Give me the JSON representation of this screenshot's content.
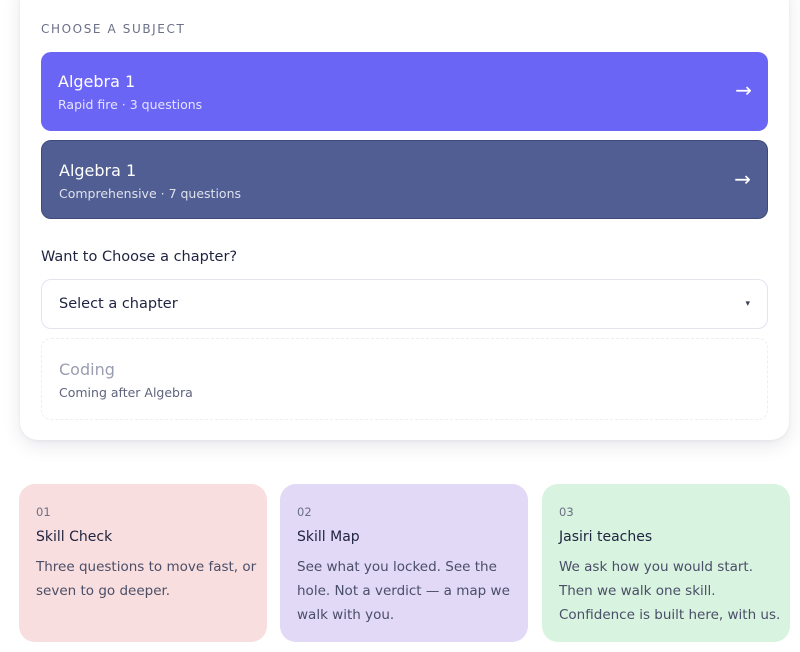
{
  "subject_picker": {
    "section_label": "CHOOSE A SUBJECT",
    "options": [
      {
        "title": "Algebra 1",
        "subtitle": "Rapid fire · 3 questions",
        "arrow": "→"
      },
      {
        "title": "Algebra 1",
        "subtitle": "Comprehensive · 7 questions",
        "arrow": "→"
      }
    ],
    "chapter_prompt": "Want to Choose a chapter?",
    "chapter_select": {
      "selected": "Select a chapter",
      "caret": "▾"
    },
    "coming_soon": {
      "title": "Coding",
      "subtitle": "Coming after Algebra"
    }
  },
  "steps": [
    {
      "number": "01",
      "title": "Skill Check",
      "description": "Three questions to move fast, or seven to go deeper.",
      "color": "#f8dede"
    },
    {
      "number": "02",
      "title": "Skill Map",
      "description": "See what you locked. See the hole. Not a verdict — a map we walk with you.",
      "color": "#e1d9f6"
    },
    {
      "number": "03",
      "title": "Jasiri teaches",
      "description": "We ask how you would start. Then we walk one skill. Confidence is built here, with us.",
      "color": "#d8f3df"
    }
  ],
  "colors": {
    "accent_primary": "#6b65f6",
    "accent_secondary": "#505e93"
  }
}
